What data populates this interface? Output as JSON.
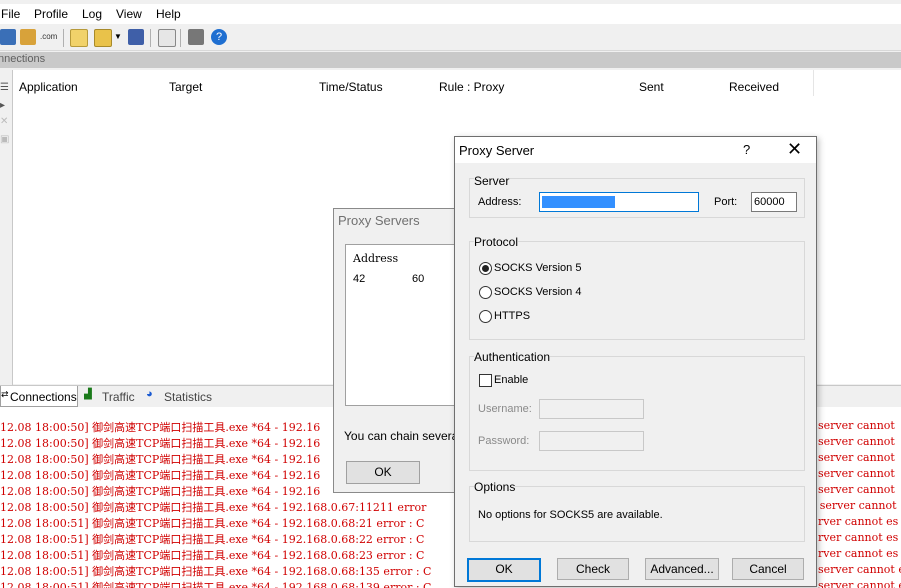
{
  "menu": [
    "File",
    "Profile",
    "Log",
    "View",
    "Help"
  ],
  "connections_header": "nnections",
  "table": {
    "columns": [
      "Application",
      "Target",
      "Time/Status",
      "Rule : Proxy",
      "Sent",
      "Received"
    ]
  },
  "tabs": [
    "Connections",
    "Traffic",
    "Statistics"
  ],
  "log": {
    "lines": [
      "12.08 18:00:50] 御剑高速TCP端口扫描工具.exe *64 - 192.16",
      "12.08 18:00:50] 御剑高速TCP端口扫描工具.exe *64 - 192.16",
      "12.08 18:00:50] 御剑高速TCP端口扫描工具.exe *64 - 192.16",
      "12.08 18:00:50] 御剑高速TCP端口扫描工具.exe *64 - 192.16",
      "12.08 18:00:50] 御剑高速TCP端口扫描工具.exe *64 - 192.16",
      "12.08 18:00:50] 御剑高速TCP端口扫描工具.exe *64 - 192.168.0.67:11211 error",
      "12.08 18:00:51] 御剑高速TCP端口扫描工具.exe *64 - 192.168.0.68:21 error : C",
      "12.08 18:00:51] 御剑高速TCP端口扫描工具.exe *64 - 192.168.0.68:22 error : C",
      "12.08 18:00:51] 御剑高速TCP端口扫描工具.exe *64 - 192.168.0.68:23 error : C",
      "12.08 18:00:51] 御剑高速TCP端口扫描工具.exe *64 - 192.168.0.68:135 error : C",
      "12.08 18:00:51] 御剑高速TCP端口扫描工具.exe *64 - 192.168.0.68:139 error : C"
    ],
    "right_fragments": [
      "server cannot",
      "server cannot",
      "server cannot",
      "server cannot",
      "server cannot",
      "y server cannot",
      "rver cannot es",
      "rver cannot es",
      "rver cannot es",
      "server cannot e",
      "server cannot e"
    ]
  },
  "proxy_servers_dialog": {
    "title": "Proxy Servers",
    "list_header": "Address",
    "list_row_address": "42",
    "list_row_port": "60",
    "chain_text": "You can chain several p",
    "ok_label": "OK"
  },
  "proxy_server_dialog": {
    "title": "Proxy Server",
    "help_glyph": "?",
    "close_glyph": "✕",
    "server_group": "Server",
    "address_label": "Address:",
    "address_value": "",
    "port_label": "Port:",
    "port_value": "60000",
    "protocol_group": "Protocol",
    "protocols": [
      "SOCKS Version 5",
      "SOCKS Version 4",
      "HTTPS"
    ],
    "selected_protocol": "SOCKS Version 5",
    "auth_group": "Authentication",
    "enable_label": "Enable",
    "enable_checked": false,
    "username_label": "Username:",
    "password_label": "Password:",
    "options_group": "Options",
    "options_text": "No options for SOCKS5 are available.",
    "buttons": {
      "ok": "OK",
      "check": "Check",
      "advanced": "Advanced...",
      "cancel": "Cancel"
    }
  },
  "colors": {
    "log_error": "#d00000",
    "selection": "#0078d7",
    "dialog_bg": "#f0f0f0"
  }
}
